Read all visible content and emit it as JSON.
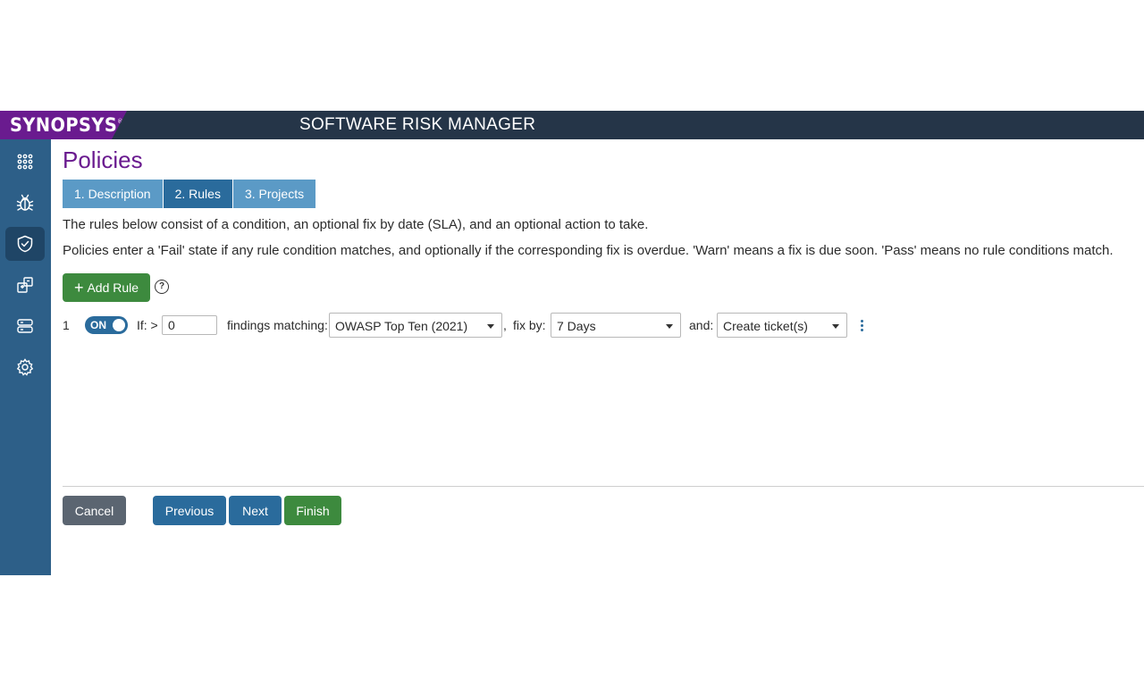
{
  "header": {
    "logo_text": "SYNOPSYS",
    "logo_mark": "®",
    "app_title": "SOFTWARE RISK MANAGER"
  },
  "sidebar": {
    "items": [
      {
        "icon": "dashboard-grid-icon",
        "active": false
      },
      {
        "icon": "bug-icon",
        "active": false
      },
      {
        "icon": "shield-check-icon",
        "active": true
      },
      {
        "icon": "integrations-icon",
        "active": false
      },
      {
        "icon": "servers-icon",
        "active": false
      },
      {
        "icon": "gear-icon",
        "active": false
      }
    ]
  },
  "page": {
    "title": "Policies",
    "steps": [
      "1. Description",
      "2. Rules",
      "3. Projects"
    ],
    "active_step": 1,
    "description_1": "The rules below consist of a condition, an optional fix by date (SLA), and an optional action to take.",
    "description_2": "Policies enter a 'Fail' state if any rule condition matches, and optionally if the corresponding fix is overdue. 'Warn' means a fix is due soon. 'Pass' means no rule conditions match."
  },
  "toolbar": {
    "add_rule_label": "Add Rule",
    "add_rule_icon": "+",
    "help_icon": "?"
  },
  "rule": {
    "number": "1",
    "toggle_label": "ON",
    "if_label": "If: >",
    "threshold_value": "0",
    "findings_label": "findings matching:",
    "findings_value": "OWASP Top Ten (2021)",
    "comma": ",",
    "fixby_label": "fix by:",
    "fixby_value": "7 Days",
    "and_label": "and:",
    "action_value": "Create ticket(s)"
  },
  "footer": {
    "cancel": "Cancel",
    "previous": "Previous",
    "next": "Next",
    "finish": "Finish"
  },
  "colors": {
    "header_bg": "#253548",
    "brand_purple": "#6a1b8f",
    "sidebar_bg": "#2d5f88",
    "primary_blue": "#2a6b9c",
    "step_blue": "#5b9ac6",
    "success_green": "#3d8a3e",
    "cancel_gray": "#5b6571"
  }
}
